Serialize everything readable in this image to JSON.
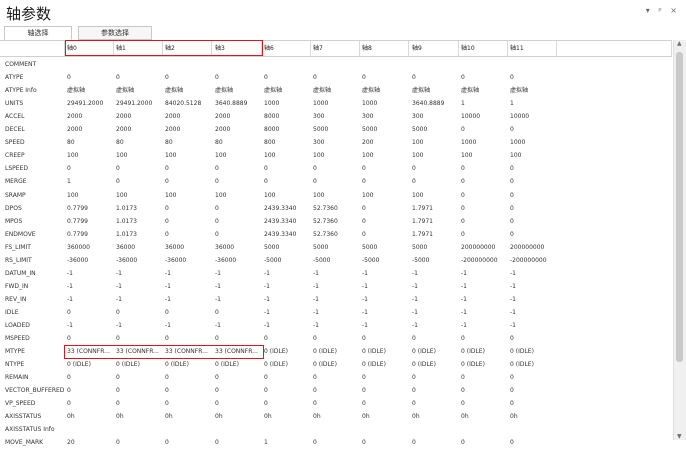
{
  "window": {
    "title": "轴参数",
    "controls": "▾ ᵖ ×"
  },
  "tabs": [
    {
      "label": "轴选择"
    },
    {
      "label": "参数选择"
    }
  ],
  "columns": [
    "轴0",
    "轴1",
    "轴2",
    "轴3",
    "轴6",
    "轴7",
    "轴8",
    "轴9",
    "轴10",
    "轴11"
  ],
  "rows": [
    {
      "label": "COMMENT",
      "values": [
        "",
        "",
        "",
        "",
        "",
        "",
        "",
        "",
        "",
        ""
      ]
    },
    {
      "label": "ATYPE",
      "values": [
        "0",
        "0",
        "0",
        "0",
        "0",
        "0",
        "0",
        "0",
        "0",
        "0"
      ]
    },
    {
      "label": "ATYPE Info",
      "values": [
        "虚拟轴",
        "虚拟轴",
        "虚拟轴",
        "虚拟轴",
        "虚拟轴",
        "虚拟轴",
        "虚拟轴",
        "虚拟轴",
        "虚拟轴",
        "虚拟轴"
      ]
    },
    {
      "label": "UNITS",
      "values": [
        "29491.2000",
        "29491.2000",
        "84020.5128",
        "3640.8889",
        "1000",
        "1000",
        "1000",
        "3640.8889",
        "1",
        "1"
      ]
    },
    {
      "label": "ACCEL",
      "values": [
        "2000",
        "2000",
        "2000",
        "2000",
        "8000",
        "300",
        "300",
        "300",
        "10000",
        "10000"
      ]
    },
    {
      "label": "DECEL",
      "values": [
        "2000",
        "2000",
        "2000",
        "2000",
        "8000",
        "5000",
        "5000",
        "5000",
        "0",
        "0"
      ]
    },
    {
      "label": "SPEED",
      "values": [
        "80",
        "80",
        "80",
        "80",
        "800",
        "300",
        "200",
        "100",
        "1000",
        "1000"
      ]
    },
    {
      "label": "CREEP",
      "values": [
        "100",
        "100",
        "100",
        "100",
        "100",
        "100",
        "100",
        "100",
        "100",
        "100"
      ]
    },
    {
      "label": "LSPEED",
      "values": [
        "0",
        "0",
        "0",
        "0",
        "0",
        "0",
        "0",
        "0",
        "0",
        "0"
      ]
    },
    {
      "label": "MERGE",
      "values": [
        "1",
        "0",
        "0",
        "0",
        "0",
        "0",
        "0",
        "0",
        "0",
        "0"
      ]
    },
    {
      "label": "SRAMP",
      "values": [
        "100",
        "100",
        "100",
        "100",
        "100",
        "100",
        "100",
        "100",
        "0",
        "0"
      ]
    },
    {
      "label": "DPOS",
      "values": [
        "0.7799",
        "1.0173",
        "0",
        "0",
        "2439.3340",
        "52.7360",
        "0",
        "1.7971",
        "0",
        "0"
      ]
    },
    {
      "label": "MPOS",
      "values": [
        "0.7799",
        "1.0173",
        "0",
        "0",
        "2439.3340",
        "52.7360",
        "0",
        "1.7971",
        "0",
        "0"
      ]
    },
    {
      "label": "ENDMOVE",
      "values": [
        "0.7799",
        "1.0173",
        "0",
        "0",
        "2439.3340",
        "52.7360",
        "0",
        "1.7971",
        "0",
        "0"
      ]
    },
    {
      "label": "FS_LIMIT",
      "values": [
        "360000",
        "36000",
        "36000",
        "36000",
        "5000",
        "5000",
        "5000",
        "5000",
        "200000000",
        "200000000"
      ]
    },
    {
      "label": "RS_LIMIT",
      "values": [
        "-36000",
        "-36000",
        "-36000",
        "-36000",
        "-5000",
        "-5000",
        "-5000",
        "-5000",
        "-200000000",
        "-200000000"
      ]
    },
    {
      "label": "DATUM_IN",
      "values": [
        "-1",
        "-1",
        "-1",
        "-1",
        "-1",
        "-1",
        "-1",
        "-1",
        "-1",
        "-1"
      ]
    },
    {
      "label": "FWD_IN",
      "values": [
        "-1",
        "-1",
        "-1",
        "-1",
        "-1",
        "-1",
        "-1",
        "-1",
        "-1",
        "-1"
      ]
    },
    {
      "label": "REV_IN",
      "values": [
        "-1",
        "-1",
        "-1",
        "-1",
        "-1",
        "-1",
        "-1",
        "-1",
        "-1",
        "-1"
      ]
    },
    {
      "label": "IDLE",
      "values": [
        "0",
        "0",
        "0",
        "0",
        "-1",
        "-1",
        "-1",
        "-1",
        "-1",
        "-1"
      ]
    },
    {
      "label": "LOADED",
      "values": [
        "-1",
        "-1",
        "-1",
        "-1",
        "-1",
        "-1",
        "-1",
        "-1",
        "-1",
        "-1"
      ]
    },
    {
      "label": "MSPEED",
      "values": [
        "0",
        "0",
        "0",
        "0",
        "0",
        "0",
        "0",
        "0",
        "0",
        "0"
      ]
    },
    {
      "label": "MTYPE",
      "values": [
        "33 (CONNFR...",
        "33 (CONNFR...",
        "33 (CONNFR...",
        "33 (CONNFR...",
        "0 (IDLE)",
        "0 (IDLE)",
        "0 (IDLE)",
        "0 (IDLE)",
        "0 (IDLE)",
        "0 (IDLE)"
      ]
    },
    {
      "label": "NTYPE",
      "values": [
        "0 (IDLE)",
        "0 (IDLE)",
        "0 (IDLE)",
        "0 (IDLE)",
        "0 (IDLE)",
        "0 (IDLE)",
        "0 (IDLE)",
        "0 (IDLE)",
        "0 (IDLE)",
        "0 (IDLE)"
      ]
    },
    {
      "label": "REMAIN",
      "values": [
        "0",
        "0",
        "0",
        "0",
        "0",
        "0",
        "0",
        "0",
        "0",
        "0"
      ]
    },
    {
      "label": "VECTOR_BUFFERED",
      "values": [
        "0",
        "0",
        "0",
        "0",
        "0",
        "0",
        "0",
        "0",
        "0",
        "0"
      ]
    },
    {
      "label": "VP_SPEED",
      "values": [
        "0",
        "0",
        "0",
        "0",
        "0",
        "0",
        "0",
        "0",
        "0",
        "0"
      ]
    },
    {
      "label": "AXISSTATUS",
      "values": [
        "0h",
        "0h",
        "0h",
        "0h",
        "0h",
        "0h",
        "0h",
        "0h",
        "0h",
        "0h"
      ]
    },
    {
      "label": "AXISSTATUS Info",
      "values": [
        "",
        "",
        "",
        "",
        "",
        "",
        "",
        "",
        "",
        ""
      ]
    },
    {
      "label": "MOVE_MARK",
      "values": [
        "20",
        "0",
        "0",
        "0",
        "1",
        "0",
        "0",
        "0",
        "0",
        "0"
      ]
    }
  ],
  "colors": {
    "highlight": "#e0141a",
    "grid": "#d8d8d8"
  }
}
